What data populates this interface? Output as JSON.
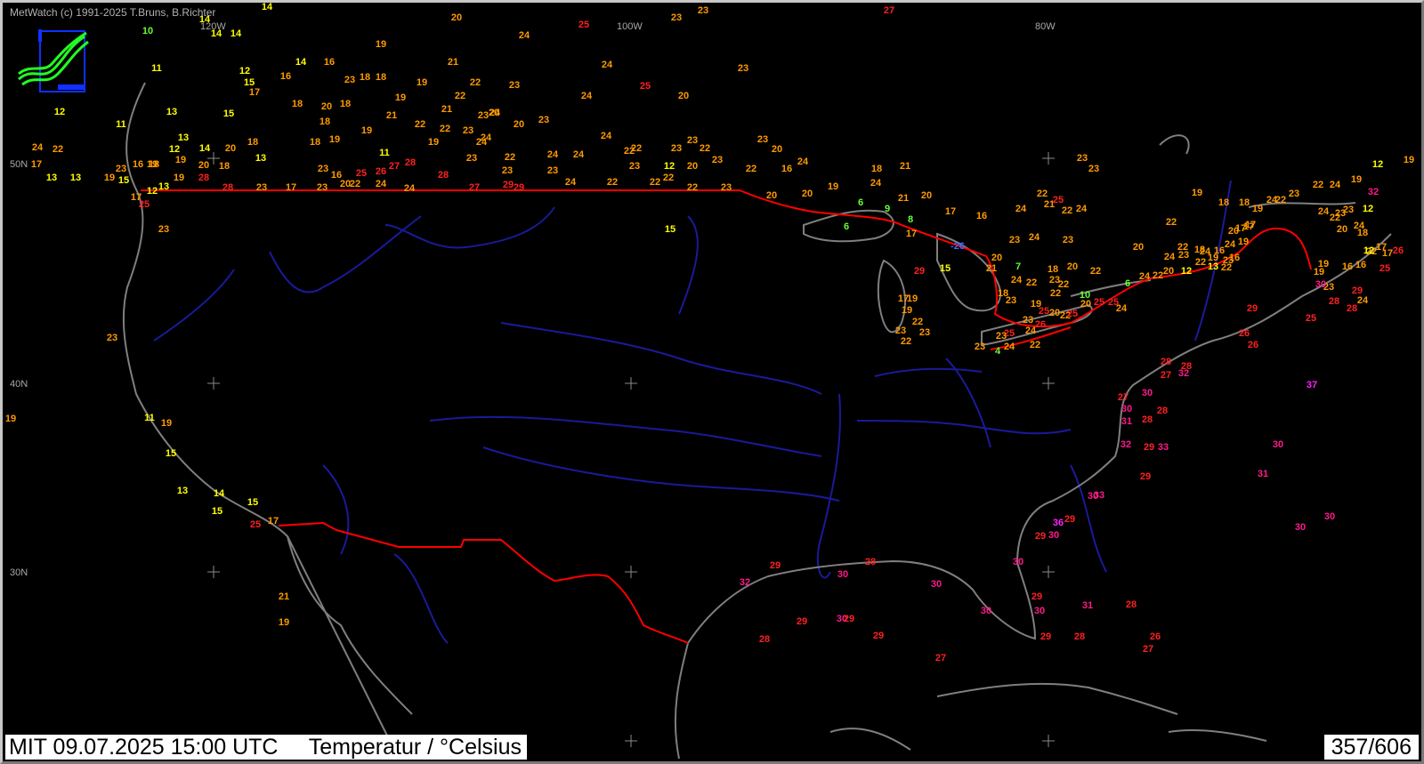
{
  "header": {
    "copyright": "MetWatch  (c) 1991-2025 T.Bruns, B.Richter"
  },
  "status": {
    "left_label": "MIT 09.07.2025 15:00 UTC     Temperatur / °Celsius",
    "right_label": "357/606"
  },
  "grid": {
    "lon_labels": [
      "120W",
      "100W",
      "80W"
    ],
    "lat_labels": [
      "50N",
      "40N",
      "30N"
    ]
  },
  "colors": {
    "background": "#000000",
    "coastline": "#7f7f7f",
    "rivers": "#1a1a9a",
    "border": "#ff0000",
    "t_cold": "#3a6cff",
    "t_10": "#66ff33",
    "t_15": "#ffff00",
    "t_20": "#ff9a00",
    "t_25": "#ff2020",
    "t_30": "#ff1a8a",
    "t_35": "#ff22ff"
  },
  "temperatures": [
    {
      "v": "14"
    },
    {
      "v": "10"
    },
    {
      "v": "14"
    },
    {
      "v": "14"
    },
    {
      "v": "14"
    },
    {
      "v": "20"
    },
    {
      "v": "23"
    },
    {
      "v": "23"
    },
    {
      "v": "27"
    },
    {
      "v": "25"
    },
    {
      "v": "24"
    },
    {
      "v": "19"
    },
    {
      "v": "11"
    },
    {
      "v": "12"
    },
    {
      "v": "16"
    },
    {
      "v": "14"
    },
    {
      "v": "16"
    },
    {
      "v": "21"
    },
    {
      "v": "24"
    },
    {
      "v": "23"
    },
    {
      "v": "25"
    },
    {
      "v": "20"
    },
    {
      "v": "15"
    },
    {
      "v": "17"
    },
    {
      "v": "23"
    },
    {
      "v": "18"
    },
    {
      "v": "18"
    },
    {
      "v": "19"
    },
    {
      "v": "22"
    },
    {
      "v": "23"
    },
    {
      "v": "24"
    },
    {
      "v": "22"
    },
    {
      "v": "18"
    },
    {
      "v": "20"
    },
    {
      "v": "19"
    },
    {
      "v": "21"
    },
    {
      "v": "23"
    },
    {
      "v": "24"
    },
    {
      "v": "12"
    },
    {
      "v": "11"
    },
    {
      "v": "13"
    },
    {
      "v": "15"
    },
    {
      "v": "18"
    },
    {
      "v": "18"
    },
    {
      "v": "19"
    },
    {
      "v": "21"
    },
    {
      "v": "22"
    },
    {
      "v": "22"
    },
    {
      "v": "23"
    },
    {
      "v": "20"
    },
    {
      "v": "20"
    },
    {
      "v": "23"
    },
    {
      "v": "24"
    },
    {
      "v": "24"
    },
    {
      "v": "22"
    },
    {
      "v": "12"
    },
    {
      "v": "14"
    },
    {
      "v": "20"
    },
    {
      "v": "18"
    },
    {
      "v": "18"
    },
    {
      "v": "19"
    },
    {
      "v": "11"
    },
    {
      "v": "19"
    },
    {
      "v": "24"
    },
    {
      "v": "24"
    },
    {
      "v": "22"
    },
    {
      "v": "22"
    },
    {
      "v": "23"
    },
    {
      "v": "23"
    },
    {
      "v": "22"
    },
    {
      "v": "23"
    },
    {
      "v": "20"
    },
    {
      "v": "13"
    },
    {
      "v": "17"
    },
    {
      "v": "13"
    },
    {
      "v": "13"
    },
    {
      "v": "23"
    },
    {
      "v": "16"
    },
    {
      "v": "18"
    },
    {
      "v": "19"
    },
    {
      "v": "20"
    },
    {
      "v": "18"
    },
    {
      "v": "13"
    },
    {
      "v": "23"
    },
    {
      "v": "16"
    },
    {
      "v": "25"
    },
    {
      "v": "26"
    },
    {
      "v": "27"
    },
    {
      "v": "28"
    },
    {
      "v": "23"
    },
    {
      "v": "22"
    },
    {
      "v": "24"
    },
    {
      "v": "24"
    },
    {
      "v": "23"
    },
    {
      "v": "23"
    },
    {
      "v": "23"
    },
    {
      "v": "12"
    },
    {
      "v": "20"
    },
    {
      "v": "23"
    },
    {
      "v": "16"
    },
    {
      "v": "24"
    },
    {
      "v": "19"
    },
    {
      "v": "15"
    },
    {
      "v": "19"
    },
    {
      "v": "12"
    },
    {
      "v": "17"
    },
    {
      "v": "13"
    },
    {
      "v": "19"
    },
    {
      "v": "28"
    },
    {
      "v": "25"
    },
    {
      "v": "23"
    },
    {
      "v": "28"
    },
    {
      "v": "23"
    },
    {
      "v": "17"
    },
    {
      "v": "23"
    },
    {
      "v": "20"
    },
    {
      "v": "22"
    },
    {
      "v": "24"
    },
    {
      "v": "24"
    },
    {
      "v": "28"
    },
    {
      "v": "27"
    },
    {
      "v": "29"
    },
    {
      "v": "29"
    },
    {
      "v": "24"
    },
    {
      "v": "22"
    },
    {
      "v": "22"
    },
    {
      "v": "22"
    },
    {
      "v": "22"
    },
    {
      "v": "23"
    },
    {
      "v": "22"
    },
    {
      "v": "20"
    },
    {
      "v": "20"
    },
    {
      "v": "19"
    },
    {
      "v": "18"
    },
    {
      "v": "21"
    },
    {
      "v": "24"
    },
    {
      "v": "21"
    },
    {
      "v": "20"
    },
    {
      "v": "6"
    },
    {
      "v": "9"
    },
    {
      "v": "6"
    },
    {
      "v": "8"
    },
    {
      "v": "17"
    },
    {
      "v": "17"
    },
    {
      "v": "16"
    },
    {
      "v": "-26"
    },
    {
      "v": "15"
    },
    {
      "v": "29"
    },
    {
      "v": "15"
    },
    {
      "v": "21"
    },
    {
      "v": "20"
    },
    {
      "v": "18"
    },
    {
      "v": "17"
    },
    {
      "v": "19"
    },
    {
      "v": "19"
    },
    {
      "v": "22"
    },
    {
      "v": "23"
    },
    {
      "v": "23"
    },
    {
      "v": "22"
    },
    {
      "v": "23"
    },
    {
      "v": "11"
    },
    {
      "v": "19"
    },
    {
      "v": "15"
    },
    {
      "v": "13"
    },
    {
      "v": "14"
    },
    {
      "v": "15"
    },
    {
      "v": "15"
    },
    {
      "v": "25"
    },
    {
      "v": "17"
    },
    {
      "v": "21"
    },
    {
      "v": "19"
    },
    {
      "v": "19"
    },
    {
      "v": "7"
    },
    {
      "v": "24"
    },
    {
      "v": "18"
    },
    {
      "v": "22"
    },
    {
      "v": "23"
    },
    {
      "v": "22"
    },
    {
      "v": "22"
    },
    {
      "v": "20"
    },
    {
      "v": "22"
    },
    {
      "v": "19"
    },
    {
      "v": "23"
    },
    {
      "v": "25"
    },
    {
      "v": "20"
    },
    {
      "v": "22"
    },
    {
      "v": "23"
    },
    {
      "v": "26"
    },
    {
      "v": "25"
    },
    {
      "v": "25"
    },
    {
      "v": "24"
    },
    {
      "v": "25"
    },
    {
      "v": "23"
    },
    {
      "v": "23"
    },
    {
      "v": "4"
    },
    {
      "v": "24"
    },
    {
      "v": "22"
    },
    {
      "v": "10"
    },
    {
      "v": "25"
    },
    {
      "v": "24"
    },
    {
      "v": "6"
    },
    {
      "v": "24"
    },
    {
      "v": "22"
    },
    {
      "v": "20"
    },
    {
      "v": "24"
    },
    {
      "v": "12"
    },
    {
      "v": "22"
    },
    {
      "v": "23"
    },
    {
      "v": "18"
    },
    {
      "v": "13"
    },
    {
      "v": "23"
    },
    {
      "v": "24"
    },
    {
      "v": "20"
    },
    {
      "v": "17"
    },
    {
      "v": "22"
    },
    {
      "v": "20"
    },
    {
      "v": "24"
    },
    {
      "v": "22"
    },
    {
      "v": "21"
    },
    {
      "v": "25"
    },
    {
      "v": "23"
    },
    {
      "v": "23"
    },
    {
      "v": "24"
    },
    {
      "v": "24"
    },
    {
      "v": "22"
    },
    {
      "v": "23"
    },
    {
      "v": "23"
    },
    {
      "v": "20"
    },
    {
      "v": "22"
    },
    {
      "v": "22"
    },
    {
      "v": "24"
    },
    {
      "v": "19"
    },
    {
      "v": "16"
    },
    {
      "v": "16"
    },
    {
      "v": "19"
    },
    {
      "v": "17"
    },
    {
      "v": "17"
    },
    {
      "v": "19"
    },
    {
      "v": "18"
    },
    {
      "v": "18"
    },
    {
      "v": "19"
    },
    {
      "v": "24"
    },
    {
      "v": "22"
    },
    {
      "v": "23"
    },
    {
      "v": "22"
    },
    {
      "v": "24"
    },
    {
      "v": "19"
    },
    {
      "v": "12"
    },
    {
      "v": "19"
    },
    {
      "v": "24"
    },
    {
      "v": "22"
    },
    {
      "v": "23"
    },
    {
      "v": "23"
    },
    {
      "v": "12"
    },
    {
      "v": "20"
    },
    {
      "v": "24"
    },
    {
      "v": "16"
    },
    {
      "v": "22"
    },
    {
      "v": "18"
    },
    {
      "v": "19"
    },
    {
      "v": "16"
    },
    {
      "v": "12"
    },
    {
      "v": "17"
    },
    {
      "v": "17"
    },
    {
      "v": "19"
    },
    {
      "v": "23"
    },
    {
      "v": "29"
    },
    {
      "v": "24"
    },
    {
      "v": "25"
    },
    {
      "v": "26"
    },
    {
      "v": "30"
    },
    {
      "v": "32"
    },
    {
      "v": "28"
    },
    {
      "v": "28"
    },
    {
      "v": "25"
    },
    {
      "v": "29"
    },
    {
      "v": "26"
    },
    {
      "v": "26"
    },
    {
      "v": "28"
    },
    {
      "v": "28"
    },
    {
      "v": "27"
    },
    {
      "v": "32"
    },
    {
      "v": "27"
    },
    {
      "v": "30"
    },
    {
      "v": "30"
    },
    {
      "v": "28"
    },
    {
      "v": "31"
    },
    {
      "v": "28"
    },
    {
      "v": "37"
    },
    {
      "v": "30"
    },
    {
      "v": "32"
    },
    {
      "v": "29"
    },
    {
      "v": "33"
    },
    {
      "v": "29"
    },
    {
      "v": "33"
    },
    {
      "v": "31"
    },
    {
      "v": "30"
    },
    {
      "v": "30"
    },
    {
      "v": "36"
    },
    {
      "v": "29"
    },
    {
      "v": "30"
    },
    {
      "v": "29"
    },
    {
      "v": "30"
    },
    {
      "v": "29"
    },
    {
      "v": "32"
    },
    {
      "v": "30"
    },
    {
      "v": "28"
    },
    {
      "v": "30"
    },
    {
      "v": "30"
    },
    {
      "v": "30"
    },
    {
      "v": "29"
    },
    {
      "v": "30"
    },
    {
      "v": "31"
    },
    {
      "v": "30"
    },
    {
      "v": "29"
    },
    {
      "v": "29"
    },
    {
      "v": "28"
    },
    {
      "v": "29"
    },
    {
      "v": "27"
    },
    {
      "v": "28"
    },
    {
      "v": "29"
    },
    {
      "v": "26"
    },
    {
      "v": "28"
    },
    {
      "v": "27"
    }
  ]
}
